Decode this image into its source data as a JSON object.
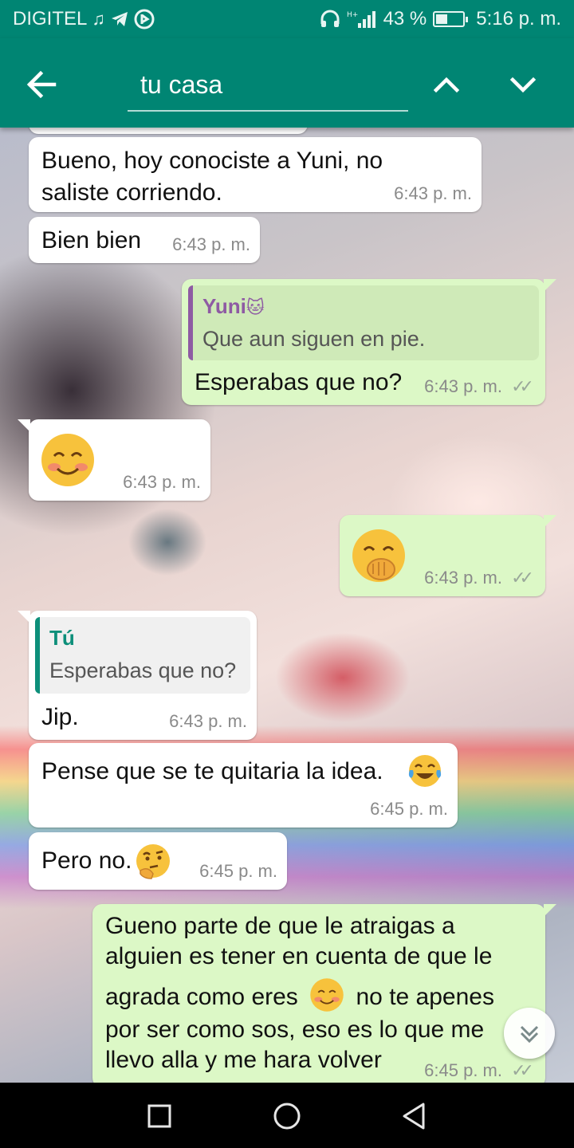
{
  "status_bar": {
    "carrier": "DIGITEL",
    "battery_text": "43 %",
    "battery_level": 0.43,
    "time": "5:16 p. m."
  },
  "toolbar": {
    "back_icon": "arrow-back-icon",
    "search_value": "tu casa",
    "search_up_icon": "chevron-up-icon",
    "search_down_icon": "chevron-down-icon"
  },
  "messages": [
    {
      "dir": "in",
      "text_line1": "Bueno, hoy conociste a Yuni, no",
      "text_line2": "saliste corriendo.",
      "time": "6:43 p. m."
    },
    {
      "dir": "in",
      "text": "Bien bien",
      "time": "6:43 p. m."
    },
    {
      "dir": "out",
      "quote_name": "Yuni",
      "quote_name_emoji": "cat-face-emoji",
      "quote_text": "Que aun siguen en pie.",
      "text": "Esperabas que no?",
      "time": "6:43 p. m.",
      "status": "read-ticks"
    },
    {
      "dir": "in",
      "emoji": "smiling-face-emoji",
      "time": "6:43 p. m."
    },
    {
      "dir": "out",
      "emoji": "hand-over-mouth-emoji",
      "time": "6:43 p. m.",
      "status": "read-ticks"
    },
    {
      "dir": "in",
      "quote_name": "Tú",
      "quote_text": "Esperabas que no?",
      "text": "Jip.",
      "time": "6:43 p. m."
    },
    {
      "dir": "in",
      "text": "Pense que se te quitaria la idea.",
      "emoji": "tears-of-joy-emoji",
      "time": "6:45 p. m."
    },
    {
      "dir": "in",
      "text": "Pero no.",
      "emoji": "thinking-face-emoji",
      "time": "6:45 p. m."
    },
    {
      "dir": "out",
      "line1": "Gueno parte de que le atraigas a",
      "line2": "alguien es tener en cuenta de que le",
      "line3a": "agrada como eres",
      "line3_emoji": "smiling-face-emoji",
      "line3b": "no te apenes",
      "line4": "por ser como sos, eso es lo que me",
      "line5": "llevo alla y me hara volver",
      "time": "6:45 p. m.",
      "status": "read-ticks"
    }
  ],
  "scroll_button_icon": "double-chevron-down-icon",
  "nav_bar": {
    "recents_icon": "square-icon",
    "home_icon": "circle-icon",
    "back_icon": "triangle-back-icon"
  },
  "colors": {
    "header": "#008573",
    "incoming_bubble": "#ffffff",
    "outgoing_bubble": "#dcf8c6",
    "quote_yuni": "#8e5aa3",
    "quote_tu": "#0d8f7a"
  }
}
